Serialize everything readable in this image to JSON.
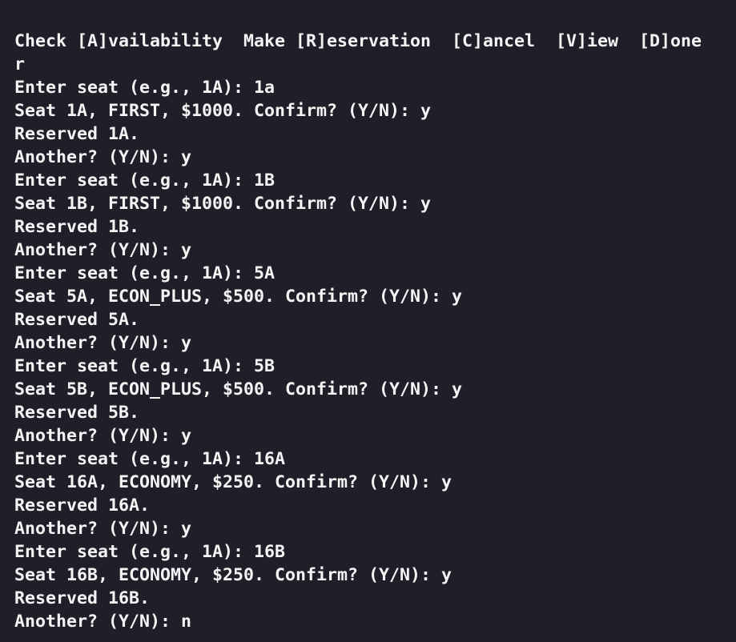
{
  "terminal": {
    "lines": [
      "Check [A]vailability  Make [R]eservation  [C]ancel  [V]iew  [D]one",
      "r",
      "Enter seat (e.g., 1A): 1a",
      "Seat 1A, FIRST, $1000. Confirm? (Y/N): y",
      "Reserved 1A.",
      "Another? (Y/N): y",
      "Enter seat (e.g., 1A): 1B",
      "Seat 1B, FIRST, $1000. Confirm? (Y/N): y",
      "Reserved 1B.",
      "Another? (Y/N): y",
      "Enter seat (e.g., 1A): 5A",
      "Seat 5A, ECON_PLUS, $500. Confirm? (Y/N): y",
      "Reserved 5A.",
      "Another? (Y/N): y",
      "Enter seat (e.g., 1A): 5B",
      "Seat 5B, ECON_PLUS, $500. Confirm? (Y/N): y",
      "Reserved 5B.",
      "Another? (Y/N): y",
      "Enter seat (e.g., 1A): 16A",
      "Seat 16A, ECONOMY, $250. Confirm? (Y/N): y",
      "Reserved 16A.",
      "Another? (Y/N): y",
      "Enter seat (e.g., 1A): 16B",
      "Seat 16B, ECONOMY, $250. Confirm? (Y/N): y",
      "Reserved 16B.",
      "Another? (Y/N): n"
    ]
  },
  "colors": {
    "background": "#1e1f29",
    "foreground": "#f4f4f4"
  }
}
